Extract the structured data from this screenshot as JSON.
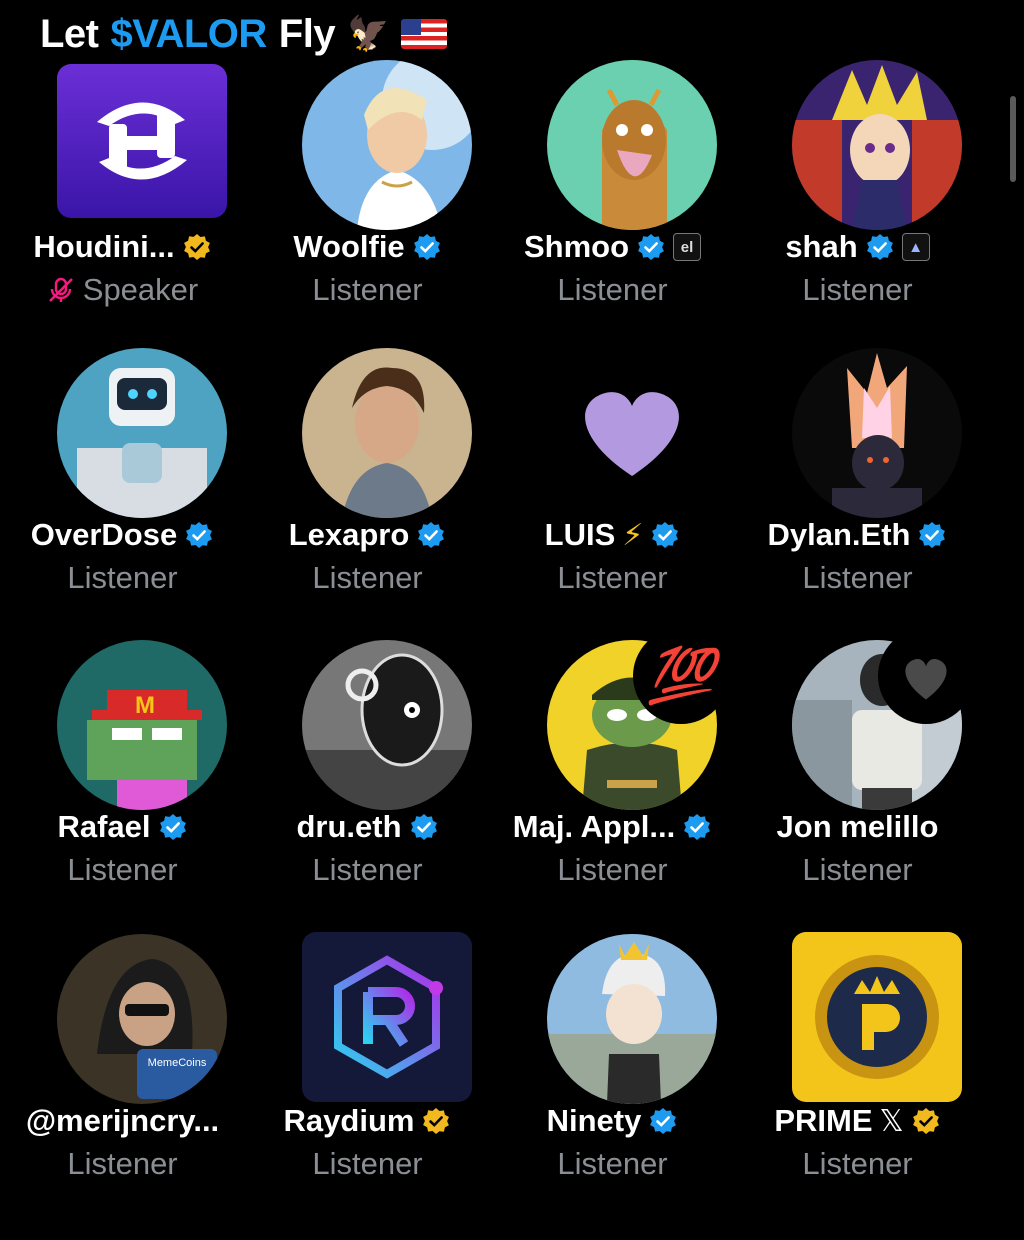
{
  "header": {
    "prefix": "Let",
    "accent": "$VALOR",
    "suffix": "Fly",
    "emoji": "🦅"
  },
  "participants": [
    {
      "name": "Houdini...",
      "role": "Speaker",
      "badge": "gold-check"
    },
    {
      "name": "Woolfie",
      "role": "Listener",
      "badge": "blue-check"
    },
    {
      "name": "Shmoo",
      "role": "Listener",
      "badge": "blue-check",
      "tag": "el"
    },
    {
      "name": "shah",
      "role": "Listener",
      "badge": "blue-check",
      "tag": "▲"
    },
    {
      "name": "OverDose",
      "role": "Listener",
      "badge": "blue-check"
    },
    {
      "name": "Lexapro",
      "role": "Listener",
      "badge": "blue-check"
    },
    {
      "name": "LUIS",
      "role": "Listener",
      "badge": "blue-check",
      "emoji": "⚡"
    },
    {
      "name": "Dylan.Eth",
      "role": "Listener",
      "badge": "blue-check"
    },
    {
      "name": "Rafael",
      "role": "Listener",
      "badge": "blue-check"
    },
    {
      "name": "dru.eth",
      "role": "Listener",
      "badge": "blue-check"
    },
    {
      "name": "Maj. Appl...",
      "role": "Listener",
      "badge": "blue-check",
      "reaction": "💯"
    },
    {
      "name": "Jon melillo",
      "role": "Listener",
      "reaction": "heart"
    },
    {
      "name": "@merijncry...",
      "role": "Listener"
    },
    {
      "name": "Raydium",
      "role": "Listener",
      "badge": "gold-check"
    },
    {
      "name": "Ninety",
      "role": "Listener",
      "badge": "blue-check"
    },
    {
      "name": "PRIME",
      "role": "Listener",
      "badge": "gold-check",
      "x_mark": "𝕏"
    }
  ],
  "colors": {
    "accent": "#1d9bf0",
    "muted": "#8b8f94",
    "gold": "#f2b91e",
    "mic_off": "#f91880"
  }
}
